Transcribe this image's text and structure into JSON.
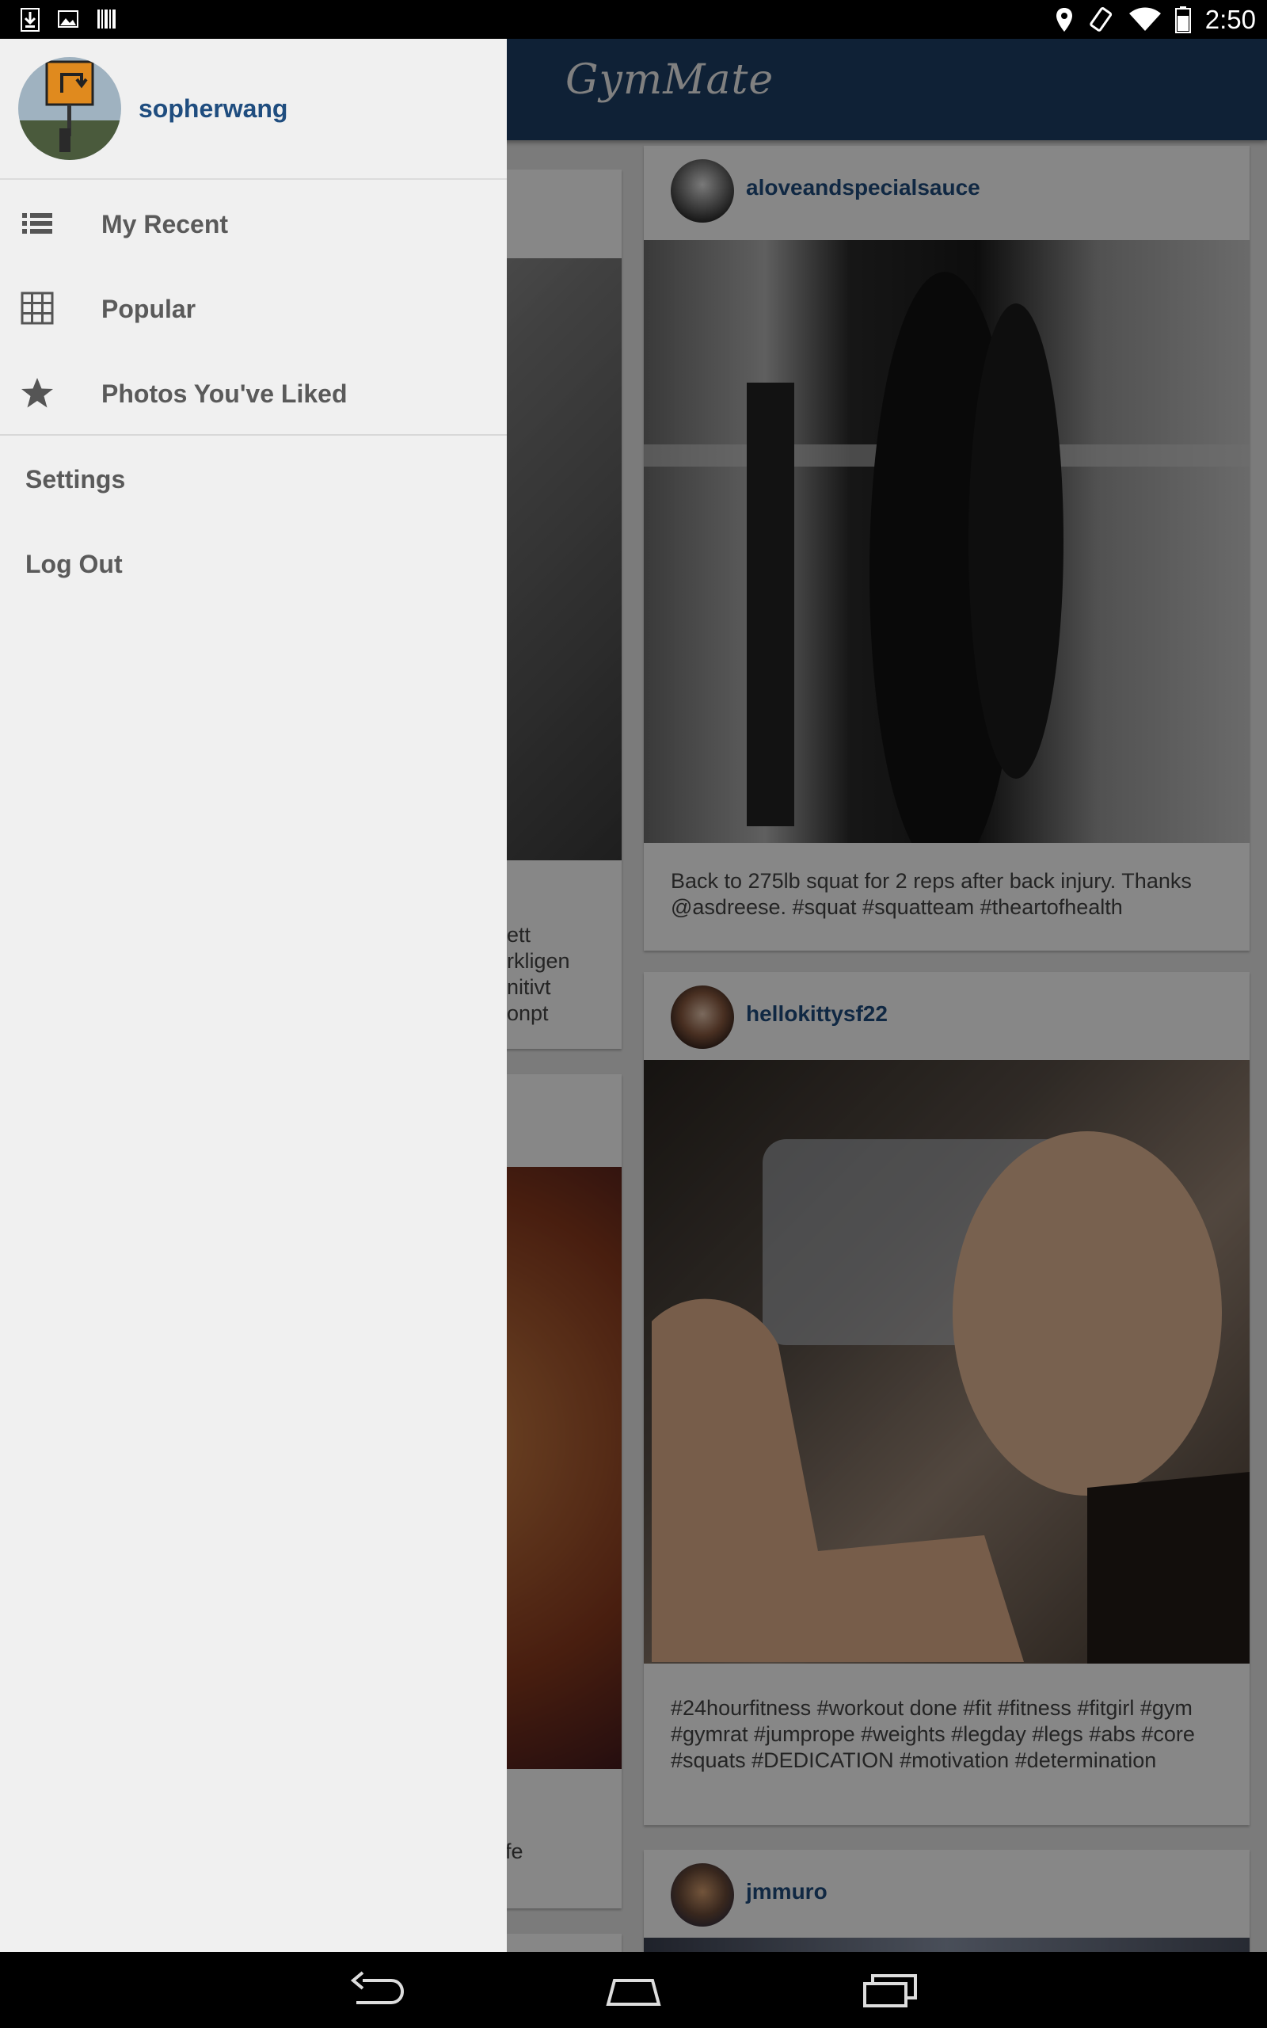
{
  "status_bar": {
    "time": "2:50",
    "left_icons": [
      "download-icon",
      "image-icon",
      "barcode-icon"
    ],
    "right_icons": [
      "location-icon",
      "rotate-icon",
      "wifi-icon",
      "battery-icon"
    ]
  },
  "app": {
    "title": "GymMate",
    "theme_color": "#1e3f66"
  },
  "feed": {
    "posts": [
      {
        "username": "aloveandspecialsauce",
        "caption": "Back to 275lb squat for 2 reps after back injury. Thanks @asdreese. #squat #squatteam #theartofhealth"
      },
      {
        "username": "hellokittysf22",
        "caption": "#24hourfitness #workout done #fit #fitness #fitgirl #gym #gymrat #jumprope #weights #legday #legs #abs #core #squats #DEDICATION #motivation #determination"
      },
      {
        "username": "jmmuro",
        "caption": ""
      }
    ],
    "left_column_fragments": [
      [
        "ett",
        "rkligen",
        "nitivt",
        "onpt"
      ],
      [
        "!",
        "ife"
      ]
    ]
  },
  "drawer": {
    "username": "sopherwang",
    "menu": [
      {
        "label": "My Recent",
        "icon": "list-icon"
      },
      {
        "label": "Popular",
        "icon": "grid-icon"
      },
      {
        "label": "Photos You've Liked",
        "icon": "star-icon"
      }
    ],
    "settings_label": "Settings",
    "logout_label": "Log Out"
  },
  "nav_bar": {
    "buttons": [
      "back-icon",
      "home-icon",
      "recents-icon"
    ]
  }
}
